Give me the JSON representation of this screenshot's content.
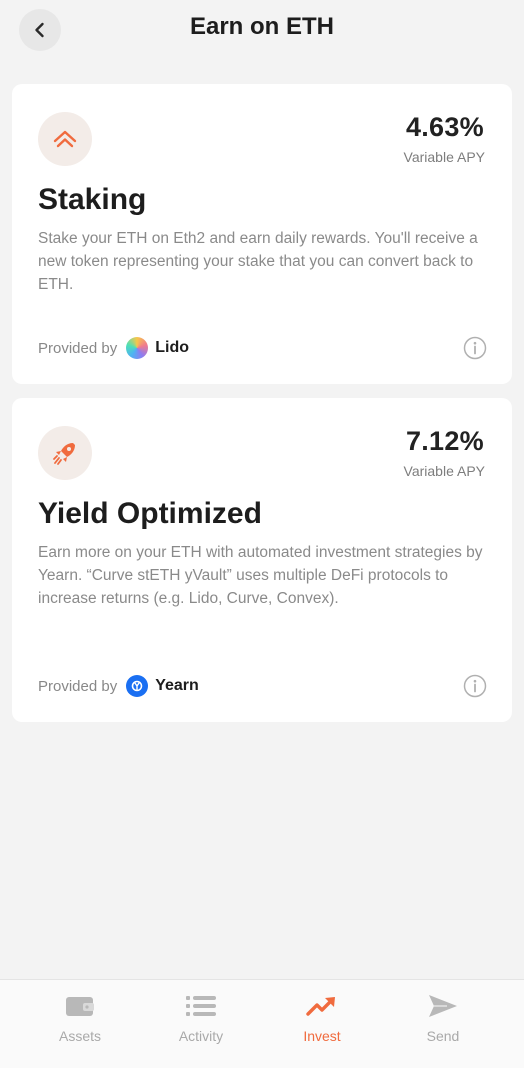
{
  "header": {
    "title": "Earn on ETH",
    "back_icon": "chevron-left-icon"
  },
  "cards": [
    {
      "icon": "double-chevron-up-icon",
      "apy": "4.63%",
      "apy_label": "Variable APY",
      "title": "Staking",
      "description": "Stake your ETH on Eth2 and earn daily rewards. You'll receive a new token representing your stake that you can convert back to ETH.",
      "provided_by": "Provided by",
      "provider": "Lido",
      "provider_icon": "lido-logo",
      "info_icon": "info-icon"
    },
    {
      "icon": "rocket-icon",
      "apy": "7.12%",
      "apy_label": "Variable APY",
      "title": "Yield Optimized",
      "description": "Earn more on your ETH with automated investment strategies by Yearn. “Curve stETH yVault” uses multiple DeFi protocols to increase returns (e.g. Lido, Curve, Convex).",
      "provided_by": "Provided by",
      "provider": "Yearn",
      "provider_icon": "yearn-logo",
      "info_icon": "info-icon"
    }
  ],
  "tabbar": {
    "active": "Invest",
    "tabs": [
      {
        "label": "Assets",
        "icon": "wallet-icon"
      },
      {
        "label": "Activity",
        "icon": "list-icon"
      },
      {
        "label": "Invest",
        "icon": "trending-up-icon"
      },
      {
        "label": "Send",
        "icon": "send-icon"
      }
    ]
  },
  "colors": {
    "accent": "#f06b3e",
    "background": "#f3f3f3",
    "card": "#ffffff",
    "inactive_tab": "#a9a9a9"
  }
}
